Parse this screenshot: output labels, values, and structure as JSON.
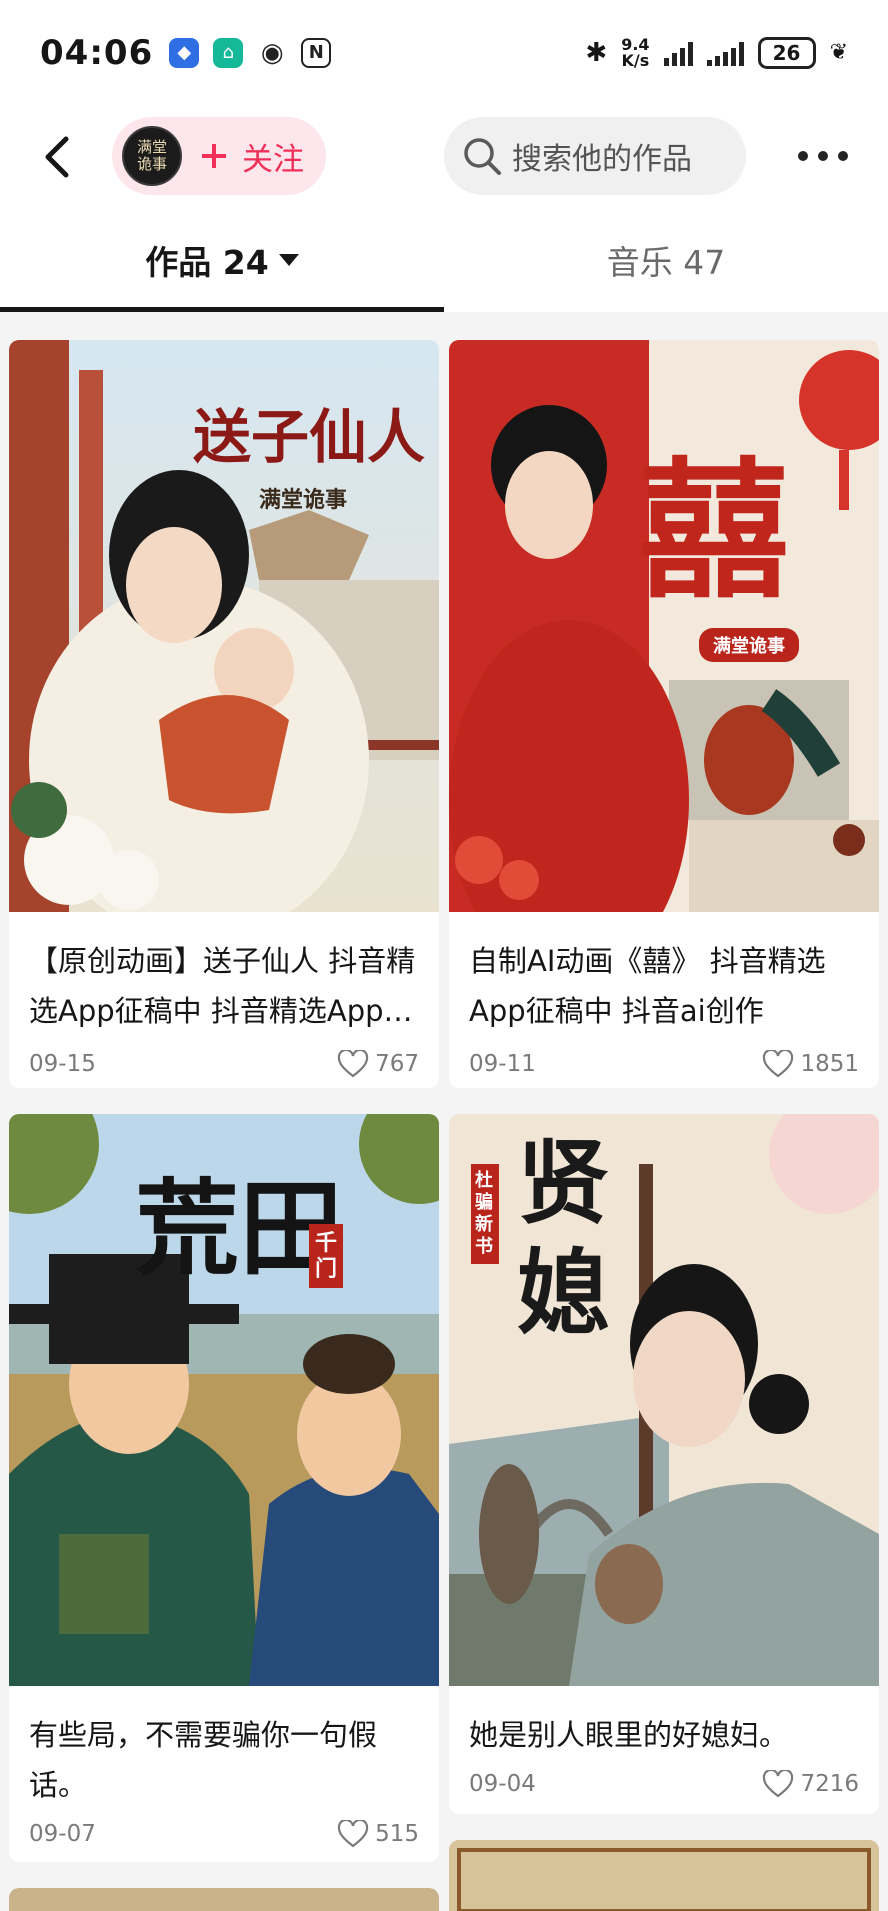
{
  "status_bar": {
    "time": "04:06",
    "net_speed_value": "9.4",
    "net_speed_unit": "K/s",
    "battery": "26"
  },
  "header": {
    "avatar_text": "满堂\n诡事",
    "follow_label": "关注",
    "search_placeholder": "搜索他的作品"
  },
  "tabs": [
    {
      "label": "作品 24",
      "active": true
    },
    {
      "label": "音乐 47",
      "active": false
    }
  ],
  "videos": [
    {
      "title": "【原创动画】送子仙人 抖音精选App征稿中 抖音精选App征稿中",
      "date": "09-15",
      "likes": "767",
      "cover_text": "送子仙人",
      "cover_sub": "满堂诡事"
    },
    {
      "title": "自制AI动画《囍》 抖音精选App征稿中 抖音ai创作",
      "date": "09-11",
      "likes": "1851",
      "cover_text": "囍",
      "cover_sub": "满堂诡事"
    },
    {
      "title": "有些局，不需要骗你一句假话。",
      "date": "09-07",
      "likes": "515",
      "cover_text": "荒田",
      "cover_sub": "千门"
    },
    {
      "title": "她是别人眼里的好媳妇。",
      "date": "09-04",
      "likes": "7216",
      "cover_text": "贤媳",
      "cover_sub": "杜骗新书"
    }
  ],
  "colors": {
    "accent": "#f1305a",
    "follow_bg": "#fde7ec",
    "text": "#161616",
    "muted": "#7a7a7a"
  }
}
